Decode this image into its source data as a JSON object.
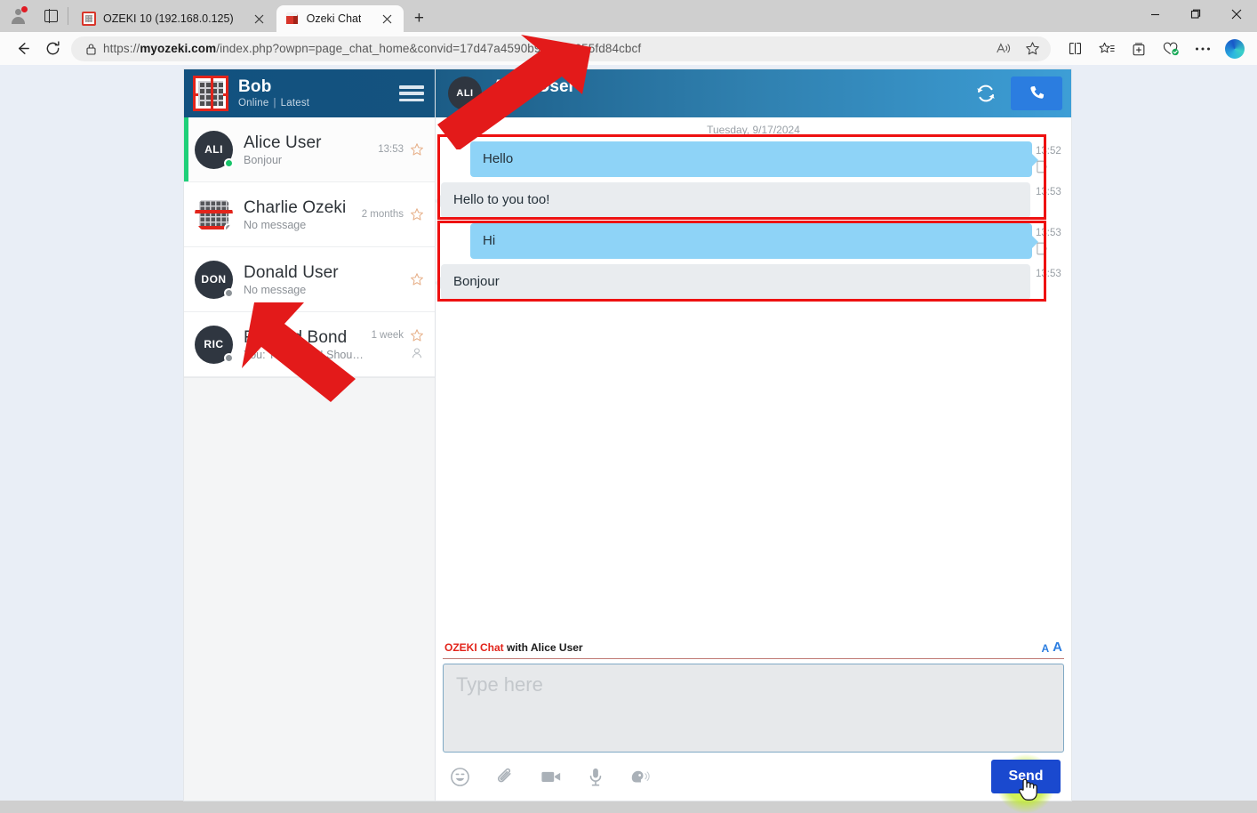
{
  "browser": {
    "profile_badge": "profile-avatar",
    "tabs": [
      {
        "title": "OZEKI 10 (192.168.0.125)",
        "active": false,
        "favicon": "ozeki-grid-icon"
      },
      {
        "title": "Ozeki Chat",
        "active": true,
        "favicon": "ozeki-cube-icon"
      }
    ],
    "new_tab_label": "+",
    "window_controls": {
      "minimize": "–",
      "maximize": "❐",
      "close": "✕"
    },
    "nav": {
      "back": "←",
      "reload": "↻"
    },
    "url": {
      "scheme": "https://",
      "host": "myozeki.com",
      "path": "/index.php?owpn=page_chat_home&convid=17d47a4590b",
      "path_tail": "9370ae055fd84cbcf",
      "full": "https://myozeki.com/index.php?owpn=page_chat_home&convid=17d47a4590b...9370ae055fd84cbcf"
    },
    "omnibox_icons": [
      "lock-icon",
      "read-aloud-icon",
      "favorite-star-icon"
    ],
    "toolbar_icons": [
      "split-screen-icon",
      "favorites-list-icon",
      "collections-icon",
      "browser-essentials-icon",
      "more-options-icon",
      "copilot-icon"
    ]
  },
  "sidebar": {
    "header": {
      "name": "Bob",
      "status": "Online",
      "separator": "|",
      "filter": "Latest",
      "menu_icon": "hamburger-menu-icon",
      "logo": "ozeki-logo"
    },
    "conversations": [
      {
        "initials": "ALI",
        "name": "Alice User",
        "preview": "Bonjour",
        "time": "13:53",
        "presence": "online",
        "selected": true,
        "avatar_type": "initials",
        "starred": false,
        "seen_icon": ""
      },
      {
        "initials": "",
        "name": "Charlie Ozeki",
        "preview": "No message",
        "time": "2 months",
        "presence": "offline",
        "selected": false,
        "avatar_type": "image",
        "starred": false,
        "seen_icon": ""
      },
      {
        "initials": "DON",
        "name": "Donald User",
        "preview": "No message",
        "time": "",
        "presence": "offline",
        "selected": false,
        "avatar_type": "initials",
        "starred": false,
        "seen_icon": ""
      },
      {
        "initials": "RIC",
        "name": "Richard Bond",
        "preview": "You: Thank you! Should we publish it?",
        "time": "1 week",
        "presence": "offline",
        "selected": false,
        "avatar_type": "initials",
        "starred": false,
        "seen_icon": "seen-person-icon"
      }
    ]
  },
  "chat": {
    "header": {
      "initials": "ALI",
      "name": "Alice User",
      "status": "Online",
      "refresh_icon": "refresh-icon",
      "call_icon": "phone-call-icon"
    },
    "day_separator": "Tuesday, 9/17/2024",
    "messages": [
      {
        "text": "Hello",
        "direction": "out",
        "time": "13:52",
        "device_icon": "mobile-device-icon"
      },
      {
        "text": "Hello to you too!",
        "direction": "in",
        "time": "13:53",
        "device_icon": ""
      },
      {
        "text": "Hi",
        "direction": "out",
        "time": "13:53",
        "device_icon": "mobile-device-icon"
      },
      {
        "text": "Bonjour",
        "direction": "in",
        "time": "13:53",
        "device_icon": ""
      }
    ]
  },
  "composer": {
    "brand": "OZEKI Chat",
    "with_label": " with Alice User",
    "font_small": "A",
    "font_large": "A",
    "input_value": "",
    "input_placeholder": "Type here",
    "tools": [
      "emoji-icon",
      "attachment-icon",
      "video-icon",
      "microphone-icon",
      "voice-message-icon"
    ],
    "send_label": "Send"
  },
  "annotations": {
    "colors": {
      "highlight_box": "#ee1111",
      "arrow": "#e31a1a",
      "accent_blue": "#2b7de0",
      "bubble_out": "#8ed3f7",
      "bubble_in": "#e9ecef",
      "presence_online": "#19c46a"
    },
    "boxes": [
      {
        "name": "first-message-pair-highlight"
      },
      {
        "name": "second-message-pair-highlight"
      }
    ],
    "arrows": [
      {
        "name": "arrow-pointing-to-first-pair"
      },
      {
        "name": "arrow-pointing-to-second-pair"
      }
    ]
  }
}
